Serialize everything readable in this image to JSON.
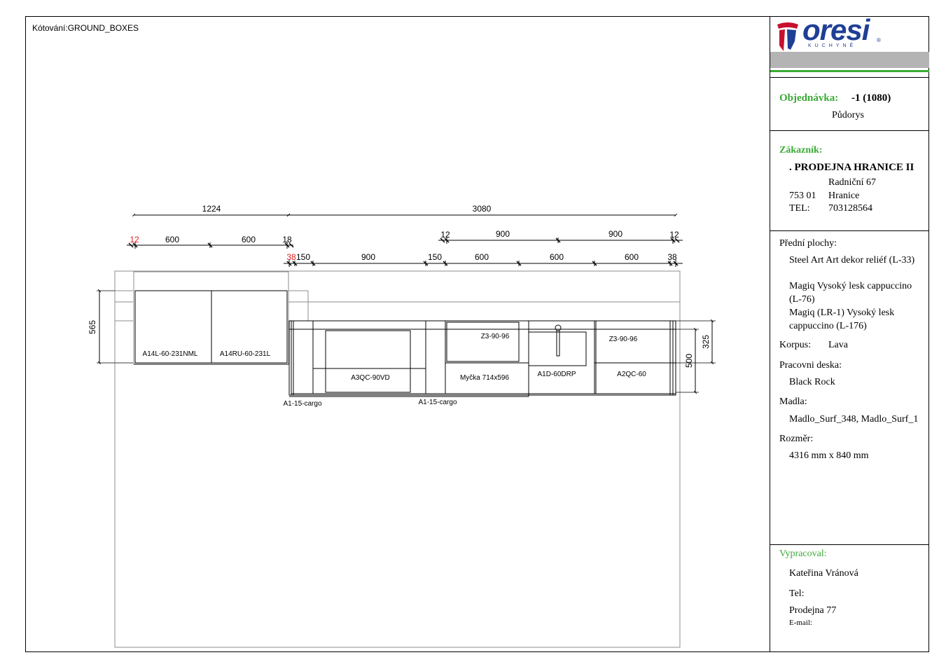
{
  "drawing": {
    "title": "Kótování:GROUND_BOXES",
    "dims_top": [
      "1224",
      "3080"
    ],
    "dims_wall": [
      "12",
      "600",
      "600",
      "18"
    ],
    "dims_upper_right": [
      "12",
      "900",
      "900",
      "12"
    ],
    "dims_base": [
      "38",
      "150",
      "900",
      "150",
      "600",
      "600",
      "600",
      "38"
    ],
    "dims_left": [
      "565"
    ],
    "dims_right": [
      "325",
      "500"
    ],
    "labels": {
      "a14l": "A14L-60-231NML",
      "a14ru": "A14RU-60-231L",
      "a3qc": "A3QC-90VD",
      "z3_1": "Z3-90-96",
      "z3_2": "Z3-90-96",
      "myc": "Myčka 714x596",
      "a1d": "A1D-60DRP",
      "a2qc": "A2QC-60",
      "cargo1": "A1-15-cargo",
      "cargo2": "A1-15-cargo"
    },
    "colors": {
      "red_dim": "#e0201c",
      "grey_line": "#8c8c8c"
    }
  },
  "title_block": {
    "logo_text": "oresi",
    "logo_sub": "KUCHYNĚ",
    "logo_reg": "®",
    "colors": {
      "brand_red": "#c8102e",
      "brand_blue": "#1f3f95",
      "bar_grey": "#b4b4b4",
      "bar_green": "#3aaa35"
    },
    "order_label": "Objednávka:",
    "order_value": "-1 (1080)",
    "plan_label": "Půdorys",
    "customer_label": "Zákazník:",
    "customer_name": ". PRODEJNA HRANICE II",
    "street": "Radniční 67",
    "zip": "753 01",
    "city": "Hranice",
    "tel_label": "TEL:",
    "tel_value": "703128564",
    "fronts_label": "Přední plochy:",
    "fronts_1": "Steel Art Art dekor reliéf (L-33)",
    "fronts_2a": "Magiq Vysoký lesk cappuccino",
    "fronts_2b": "(L-76)",
    "fronts_3a": "Magiq  (LR-1) Vysoký lesk",
    "fronts_3b": "cappuccino (L-176)",
    "korpus_label": "Korpus:",
    "korpus_value": "Lava",
    "worktop_label": "Pracovni deska:",
    "worktop_value": "Black Rock",
    "handles_label": "Madla:",
    "handles_value": "Madlo_Surf_348, Madlo_Surf_1",
    "size_label": "Rozměr:",
    "size_value": "4316 mm x 840 mm",
    "author_label": "Vypracoval:",
    "author_value": "Kateřina Vránová",
    "tel2_label": "Tel:",
    "shop_value": "Prodejna 77",
    "email_label": "E-mail:"
  }
}
